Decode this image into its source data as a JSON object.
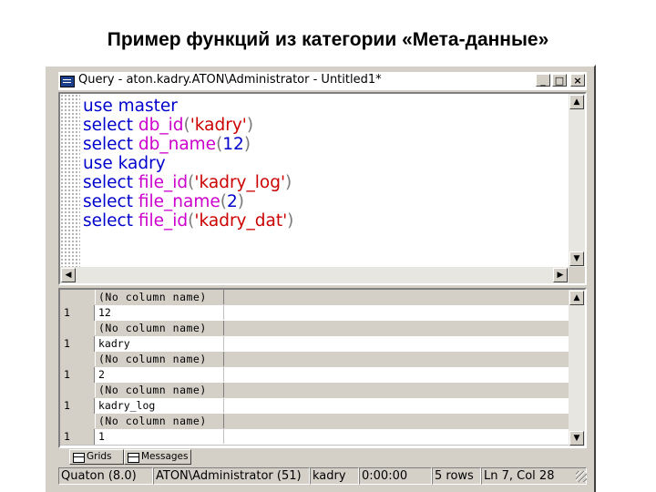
{
  "slide": {
    "title": "Пример функций из категории «Мета-данные»"
  },
  "window": {
    "title": "Query - aton.kadry.ATON\\Administrator - Untitled1*",
    "buttons": {
      "minimize": "_",
      "maximize": "□",
      "close": "×"
    }
  },
  "editor": {
    "lines": [
      [
        {
          "t": "use",
          "c": "kw"
        },
        {
          "t": " master",
          "c": "kw"
        }
      ],
      [
        {
          "t": "select",
          "c": "kw"
        },
        {
          "t": " ",
          "c": "kw"
        },
        {
          "t": "db_id",
          "c": "fn"
        },
        {
          "t": "(",
          "c": "pn"
        },
        {
          "t": "'kadry'",
          "c": "str"
        },
        {
          "t": ")",
          "c": "pn"
        }
      ],
      [
        {
          "t": "select",
          "c": "kw"
        },
        {
          "t": " ",
          "c": "kw"
        },
        {
          "t": "db_name",
          "c": "fn"
        },
        {
          "t": "(",
          "c": "pn"
        },
        {
          "t": "12",
          "c": "kw"
        },
        {
          "t": ")",
          "c": "pn"
        }
      ],
      [
        {
          "t": "use",
          "c": "kw"
        },
        {
          "t": " kadry",
          "c": "kw"
        }
      ],
      [
        {
          "t": "select",
          "c": "kw"
        },
        {
          "t": " ",
          "c": "kw"
        },
        {
          "t": "file_id",
          "c": "fn"
        },
        {
          "t": "(",
          "c": "pn"
        },
        {
          "t": "'kadry_log'",
          "c": "str"
        },
        {
          "t": ")",
          "c": "pn"
        }
      ],
      [
        {
          "t": "select",
          "c": "kw"
        },
        {
          "t": " ",
          "c": "kw"
        },
        {
          "t": "file_name",
          "c": "fn"
        },
        {
          "t": "(",
          "c": "pn"
        },
        {
          "t": "2",
          "c": "kw"
        },
        {
          "t": ")",
          "c": "pn"
        }
      ],
      [
        {
          "t": "select",
          "c": "kw"
        },
        {
          "t": " ",
          "c": "kw"
        },
        {
          "t": "file_id",
          "c": "fn"
        },
        {
          "t": "(",
          "c": "pn"
        },
        {
          "t": "'kadry_dat'",
          "c": "str"
        },
        {
          "t": ")",
          "c": "pn"
        }
      ]
    ]
  },
  "results": {
    "sets": [
      {
        "header": "(No column name)",
        "row_num": "1",
        "value": "12"
      },
      {
        "header": "(No column name)",
        "row_num": "1",
        "value": "kadry"
      },
      {
        "header": "(No column name)",
        "row_num": "1",
        "value": "2"
      },
      {
        "header": "(No column name)",
        "row_num": "1",
        "value": "kadry_log"
      },
      {
        "header": "(No column name)",
        "row_num": "1",
        "value": "1"
      }
    ]
  },
  "tabs": {
    "grids": "Grids",
    "messages": "Messages"
  },
  "status": {
    "cells": [
      "Quaton (8.0)",
      "ATON\\Administrator (51)",
      "kadry",
      "0:00:00",
      "5 rows",
      "Ln 7, Col 28"
    ]
  }
}
